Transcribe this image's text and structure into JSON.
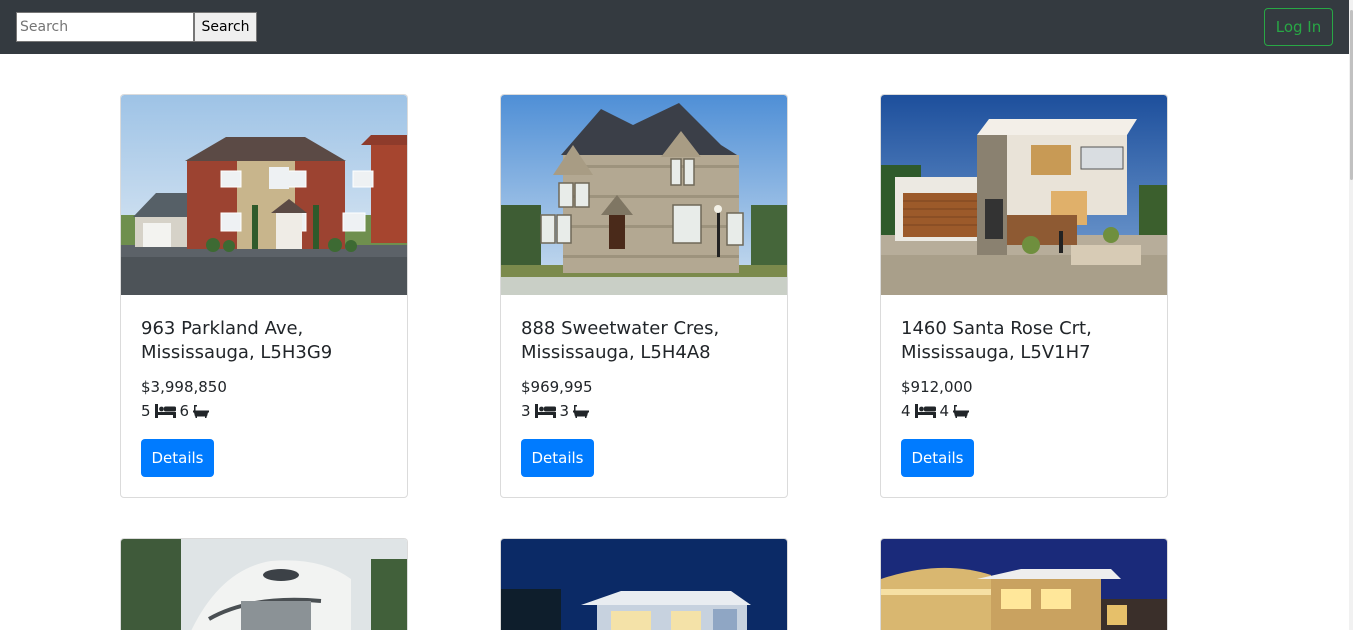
{
  "navbar": {
    "search_placeholder": "Search",
    "search_button": "Search",
    "login_button": "Log In",
    "colors": {
      "background": "#343a40",
      "login_accent": "#28a745"
    }
  },
  "listings": [
    {
      "address_line1": "963 Parkland Ave,",
      "address_line2": "Mississauga, L5H3G9",
      "price": "$3,998,850",
      "beds": "5",
      "baths": "6",
      "details_label": "Details",
      "photo_icon": "house-photo"
    },
    {
      "address_line1": "888 Sweetwater Cres,",
      "address_line2": "Mississauga, L5H4A8",
      "price": "$969,995",
      "beds": "3",
      "baths": "3",
      "details_label": "Details",
      "photo_icon": "house-photo"
    },
    {
      "address_line1": "1460 Santa Rose Crt,",
      "address_line2": "Mississauga, L5V1H7",
      "price": "$912,000",
      "beds": "4",
      "baths": "4",
      "details_label": "Details",
      "photo_icon": "house-photo"
    }
  ],
  "icons": {
    "bed": "bed-icon",
    "bath": "bath-icon"
  },
  "accent_color": "#007bff"
}
